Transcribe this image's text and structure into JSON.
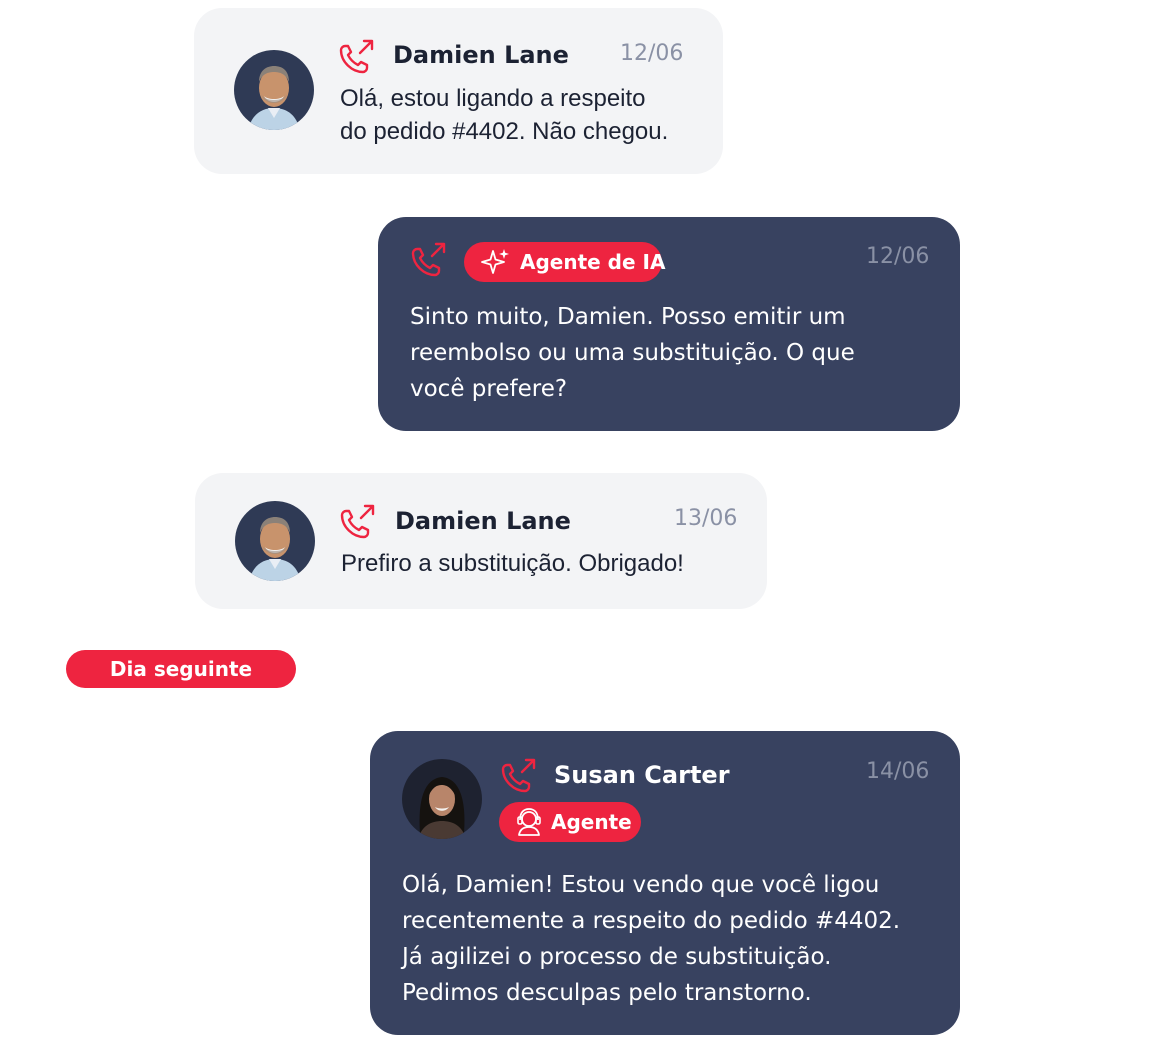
{
  "colors": {
    "accent": "#ee2440",
    "dark_bubble": "#384260",
    "light_bubble": "#f3f4f6",
    "date_text": "#8a91a5"
  },
  "messages": [
    {
      "sender": "Damien Lane",
      "date": "12/06",
      "text": "Olá, estou ligando a respeito\ndo pedido #4402. Não chegou.",
      "icon": "phone-outgoing-icon"
    },
    {
      "badge": "Agente de IA",
      "badge_icon": "sparkles-icon",
      "date": "12/06",
      "text": "Sinto muito, Damien. Posso emitir um\nreembolso ou uma substituição. O que\nvocê prefere?",
      "icon": "phone-outgoing-icon"
    },
    {
      "sender": "Damien Lane",
      "date": "13/06",
      "text": "Prefiro a substituição. Obrigado!",
      "icon": "phone-outgoing-icon"
    },
    {
      "sender": "Susan Carter",
      "badge": "Agente",
      "badge_icon": "agent-headset-icon",
      "date": "14/06",
      "text": "Olá, Damien! Estou vendo que você ligou\nrecentemente a respeito do pedido #4402.\nJá agilizei o processo de substituição.\nPedimos desculpas pelo transtorno.",
      "icon": "phone-outgoing-icon"
    }
  ],
  "day_separator": "Dia seguinte"
}
